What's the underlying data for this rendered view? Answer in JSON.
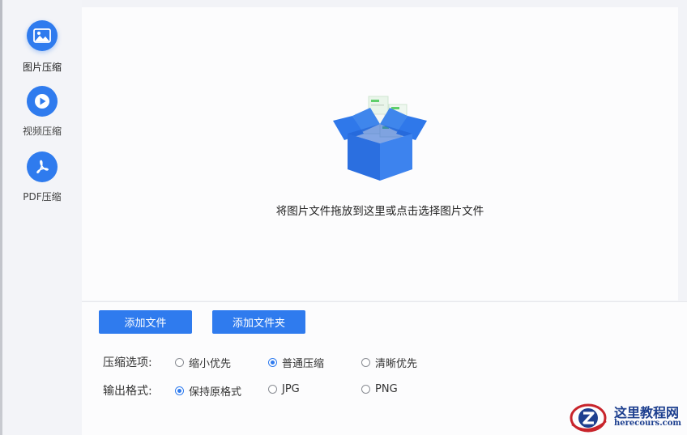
{
  "sidebar": {
    "items": [
      {
        "label": "图片压缩",
        "icon": "image-icon",
        "active": true
      },
      {
        "label": "视频压缩",
        "icon": "play-icon",
        "active": false
      },
      {
        "label": "PDF压缩",
        "icon": "pdf-icon",
        "active": false
      }
    ]
  },
  "dropzone": {
    "hint": "将图片文件拖放到这里或点击选择图片文件",
    "illustration": "open-box-icon"
  },
  "toolbar": {
    "add_file_label": "添加文件",
    "add_folder_label": "添加文件夹"
  },
  "options": {
    "compression": {
      "label": "压缩选项:",
      "choices": [
        "缩小优先",
        "普通压缩",
        "清晰优先"
      ],
      "selected": "普通压缩"
    },
    "output": {
      "label": "输出格式:",
      "choices": [
        "保持原格式",
        "JPG",
        "PNG"
      ],
      "selected": "保持原格式"
    }
  },
  "watermark": {
    "title": "这里教程网",
    "url": "herecours.com"
  },
  "colors": {
    "accent": "#2f7bee",
    "panel": "#fcfcfd",
    "sidebar": "#f3f4f8",
    "watermark_text": "#1d3f8f",
    "watermark_red": "#c8242b"
  }
}
